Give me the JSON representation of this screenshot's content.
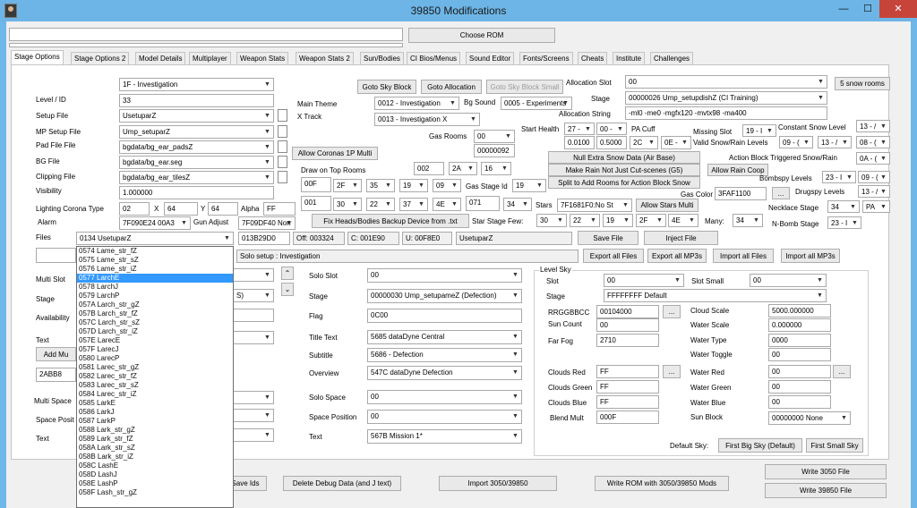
{
  "window": {
    "title": "39850 Modifications",
    "min_label": "—",
    "max_label": "☐",
    "close_label": "✕",
    "choose_rom": "Choose ROM"
  },
  "tabs": [
    "Stage Options",
    "Stage Options 2",
    "Model Details",
    "Multiplayer",
    "Weapon Stats",
    "Weapon Stats 2",
    "Sun/Bodies",
    "CI Bios/Menus",
    "Sound Editor",
    "Fonts/Screens",
    "Cheats",
    "Institute",
    "Challenges"
  ],
  "left": {
    "stage_select": "1F - Investigation",
    "level_id_label": "Level / ID",
    "level_id": "33",
    "setup_file_label": "Setup File",
    "setup_file": "UsetuparZ",
    "mp_setup_label": "MP Setup File",
    "mp_setup": "Ump_setuparZ",
    "pad_file_label": "Pad File File",
    "pad_file": "bgdata/bg_ear_padsZ",
    "bg_file_label": "BG File",
    "bg_file": "bgdata/bg_ear.seg",
    "clipping_label": "Clipping File",
    "clipping": "bgdata/bg_ear_tilesZ",
    "visibility_label": "Visibility",
    "visibility": "1.000000",
    "corona_label": "Lighting Corona Type",
    "corona": "02",
    "x_label": "X",
    "x_val": "64",
    "y_label": "Y",
    "y_val": "64",
    "alpha_label": "Alpha",
    "alpha": "FF",
    "alarm_label": "Alarm",
    "alarm": "7F090E24 00A3",
    "gun_adjust_label": "Gun Adjust",
    "gun_adjust": "7F09DF40 Norr",
    "files_label": "Files",
    "files_select": "0134 UsetuparZ",
    "multi_slot_label": "Multi Slot",
    "stage_label": "Stage",
    "availability_label": "Availability",
    "text_label": "Text",
    "add_mu": "Add Mu",
    "val_2abb": "2ABB8",
    "multi_space_label": "Multi Space",
    "space_posit_label": "Space Posit",
    "text2_label": "Text",
    "stage_partial": "S)"
  },
  "files_list": [
    "0574 Lame_str_fZ",
    "0575 Lame_str_sZ",
    "0576 Lame_str_iZ",
    "0577 LarchE",
    "0578 LarchJ",
    "0579 LarchP",
    "057A Larch_str_gZ",
    "057B Larch_str_fZ",
    "057C Larch_str_sZ",
    "057D Larch_str_iZ",
    "057E LarecE",
    "057F LarecJ",
    "0580 LarecP",
    "0581 Larec_str_gZ",
    "0582 Larec_str_fZ",
    "0583 Larec_str_sZ",
    "0584 Larec_str_iZ",
    "0585 LarkE",
    "0586 LarkJ",
    "0587 LarkP",
    "0588 Lark_str_gZ",
    "0589 Lark_str_fZ",
    "058A Lark_str_sZ",
    "058B Lark_str_iZ",
    "058C LashE",
    "058D LashJ",
    "058E LashP",
    "058F Lash_str_gZ"
  ],
  "files_selected_index": 3,
  "middle": {
    "goto_sky": "Goto Sky Block",
    "goto_alloc": "Goto Allocation",
    "goto_sky_small": "Goto Sky Block Small",
    "main_theme_label": "Main Theme",
    "main_theme": "0012 - Investigation",
    "bg_sound_label": "Bg Sound",
    "bg_sound": "0005 - Experiments",
    "x_track_label": "X Track",
    "x_track": "0013 - Investigation X",
    "gas_rooms_label": "Gas Rooms",
    "gas_rooms": "00",
    "gas_rooms_val": "00000092",
    "allow_coronas": "Allow Coronas 1P Multi",
    "draw_top_label": "Draw on Top Rooms",
    "draw_top_a": "002",
    "draw_top_b": "2A",
    "draw_top_c": "16",
    "r1_a": "00F",
    "r1_b": "2F",
    "r1_c": "35",
    "r1_d": "19",
    "r1_e": "09",
    "gas_stage_id_label": "Gas Stage Id",
    "gas_stage_id": "19",
    "r2_a": "001",
    "r2_b": "30",
    "r2_c": "22",
    "r2_d": "37",
    "r2_e": "4E",
    "r2_f": "071",
    "r2_g": "34",
    "stars_label": "Stars",
    "stars": "7F1681F0:No St",
    "allow_stars_multi": "Allow Stars Multi",
    "fix_heads": "Fix Heads/Bodies Backup Device from .txt",
    "star_stage_few_label": "Star Stage Few:",
    "ssf_a": "30",
    "ssf_b": "22",
    "ssf_c": "19",
    "ssf_d": "2F",
    "ssf_e": "4E",
    "many_label": "Many:",
    "many": "34",
    "ptr": "013B29D0",
    "off": "Off: 003324",
    "c_val": "C: 001E90",
    "u_val": "U: 00F8E0",
    "setup_name": "UsetuparZ",
    "save_file": "Save File",
    "inject_file": "Inject File",
    "solo_setup": "Solo setup : Investigation",
    "export_all_files": "Export all Files",
    "export_all_mp3": "Export all MP3s",
    "import_all_files": "Import all Files",
    "import_all_mp3": "Import all MP3s"
  },
  "right": {
    "alloc_slot_label": "Allocation Slot",
    "alloc_slot": "00",
    "snow_rooms": "5 snow rooms",
    "stage_label": "Stage",
    "stage": "00000026 Ump_setupdishZ (CI Training)",
    "alloc_string_label": "Allocation String",
    "alloc_string": "-ml0 -me0 -mgfx120 -mvtx98 -ma400",
    "start_health_label": "Start Health",
    "sh_a": "27 -",
    "sh_b": "00 -",
    "pa_cuff_label": "PA Cuff",
    "missing_slot_label": "Missing Slot",
    "missing_slot": "19 - I",
    "const_snow_label": "Constant Snow Level",
    "const_snow": "13 - /",
    "v_a": "0.0100",
    "v_b": "0.5000",
    "pa_a": "2C",
    "pa_b": "0E -",
    "valid_snow_label": "Valid Snow/Rain Levels",
    "vs_a": "09 - (",
    "vs_b": "13 - /",
    "vs_c": "08 - (",
    "null_snow": "Null Extra Snow Data (Air Base)",
    "action_block_label": "Action Block Triggered Snow/Rain",
    "action_block": "0A - (",
    "make_rain": "Make Rain Not Just Cut-scenes (G5)",
    "allow_rain_coop": "Allow Rain Coop",
    "bombspy_label": "Bombspy Levels",
    "bs_a": "23 - I",
    "bs_b": "09 - (",
    "split_add": "Split to Add Rooms for Action Block Snow",
    "gas_color_label": "Gas Color",
    "gas_color": "3FAF1100",
    "ellipsis": "...",
    "drugspy_label": "Drugspy Levels",
    "drugspy": "13 - /",
    "necklace_label": "Necklace Stage",
    "necklace": "34",
    "pa": "PA",
    "nbomb_label": "N-Bomb Stage",
    "nbomb": "23 - I"
  },
  "solo": {
    "solo_slot_label": "Solo Slot",
    "solo_slot": "00",
    "stage_label": "Stage",
    "stage": "00000030 Ump_setupameZ (Defection)",
    "flag_label": "Flag",
    "flag": "0C00",
    "title_text_label": "Title Text",
    "title_text": "5685 dataDyne Central",
    "subtitle_label": "Subtitle",
    "subtitle": "5686 - Defection",
    "overview_label": "Overview",
    "overview": "547C dataDyne Defection",
    "solo_space_label": "Solo Space",
    "solo_space": "00",
    "space_pos_label": "Space Position",
    "space_pos": "00",
    "text_label": "Text",
    "text": "567B Mission 1*"
  },
  "sky": {
    "group_label": "Level Sky",
    "slot_label": "Slot",
    "slot": "00",
    "slot_small_label": "Slot Small",
    "slot_small": "00",
    "stage_label": "Stage",
    "stage": "FFFFFFFF Default",
    "rrggbbcc_label": "RRGGBBCC",
    "rrggbbcc": "00104000",
    "sun_count_label": "Sun Count",
    "sun_count": "00",
    "far_fog_label": "Far Fog",
    "far_fog": "2710",
    "cloud_scale_label": "Cloud Scale",
    "cloud_scale": "5000.000000",
    "water_scale_label": "Water Scale",
    "water_scale": "0.000000",
    "water_type_label": "Water Type",
    "water_type": "0000",
    "water_toggle_label": "Water Toggle",
    "water_toggle": "00",
    "clouds_red_label": "Clouds Red",
    "clouds_red": "FF",
    "clouds_green_label": "Clouds Green",
    "clouds_green": "FF",
    "clouds_blue_label": "Clouds Blue",
    "clouds_blue": "FF",
    "blend_mult_label": "Blend Mult",
    "blend_mult": "000F",
    "water_red_label": "Water Red",
    "water_red": "00",
    "water_green_label": "Water Green",
    "water_green": "00",
    "water_blue_label": "Water Blue",
    "water_blue": "00",
    "sun_block_label": "Sun Block",
    "sun_block": "00000000 None",
    "default_sky_label": "Default Sky:",
    "first_big_sky": "First Big Sky (Default)",
    "first_small_sky": "First Small Sky",
    "ellipsis": "..."
  },
  "bottom": {
    "save_ids": "Save Ids",
    "delete_debug": "Delete Debug Data (and J text)",
    "import_3050": "Import 3050/39850",
    "write_rom": "Write ROM with 3050/39850 Mods",
    "write_3050": "Write 3050 File",
    "write_39850": "Write 39850 File"
  }
}
